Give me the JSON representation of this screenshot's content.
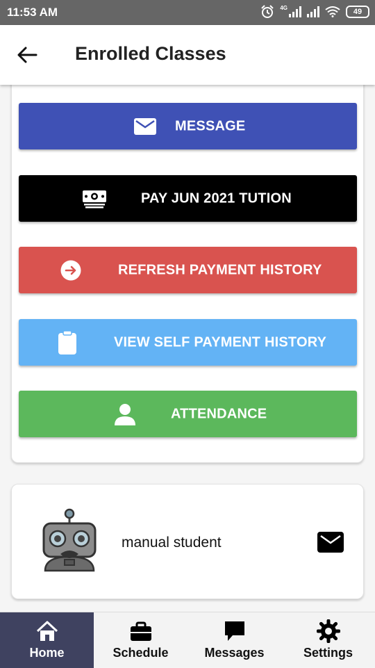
{
  "status_bar": {
    "time": "11:53 AM",
    "network_label": "4G",
    "battery": "49",
    "icons": [
      "alarm-icon",
      "signal-icon",
      "signal-icon",
      "wifi-icon",
      "battery-icon"
    ]
  },
  "app_bar": {
    "back_icon": "arrow-left-icon",
    "title": "Enrolled Classes"
  },
  "actions": [
    {
      "label": "MESSAGE",
      "icon": "envelope-icon",
      "color": "#3f51b5"
    },
    {
      "label": "PAY JUN 2021 TUTION",
      "icon": "money-icon",
      "color": "#000000"
    },
    {
      "label": "REFRESH PAYMENT HISTORY",
      "icon": "arrow-circle-right-icon",
      "color": "#d9534f"
    },
    {
      "label": "VIEW SELF PAYMENT HISTORY",
      "icon": "clipboard-icon",
      "color": "#63b3f5"
    },
    {
      "label": "ATTENDANCE",
      "icon": "user-icon",
      "color": "#5cb85c"
    }
  ],
  "student": {
    "name": "manual student",
    "avatar_icon": "robot-avatar-icon",
    "mail_icon": "envelope-icon"
  },
  "bottom_nav": {
    "items": [
      {
        "label": "Home",
        "icon": "home-icon",
        "active": true
      },
      {
        "label": "Schedule",
        "icon": "briefcase-icon",
        "active": false
      },
      {
        "label": "Messages",
        "icon": "chat-bubble-icon",
        "active": false
      },
      {
        "label": "Settings",
        "icon": "gear-icon",
        "active": false
      }
    ],
    "active_color": "#3f4260"
  }
}
